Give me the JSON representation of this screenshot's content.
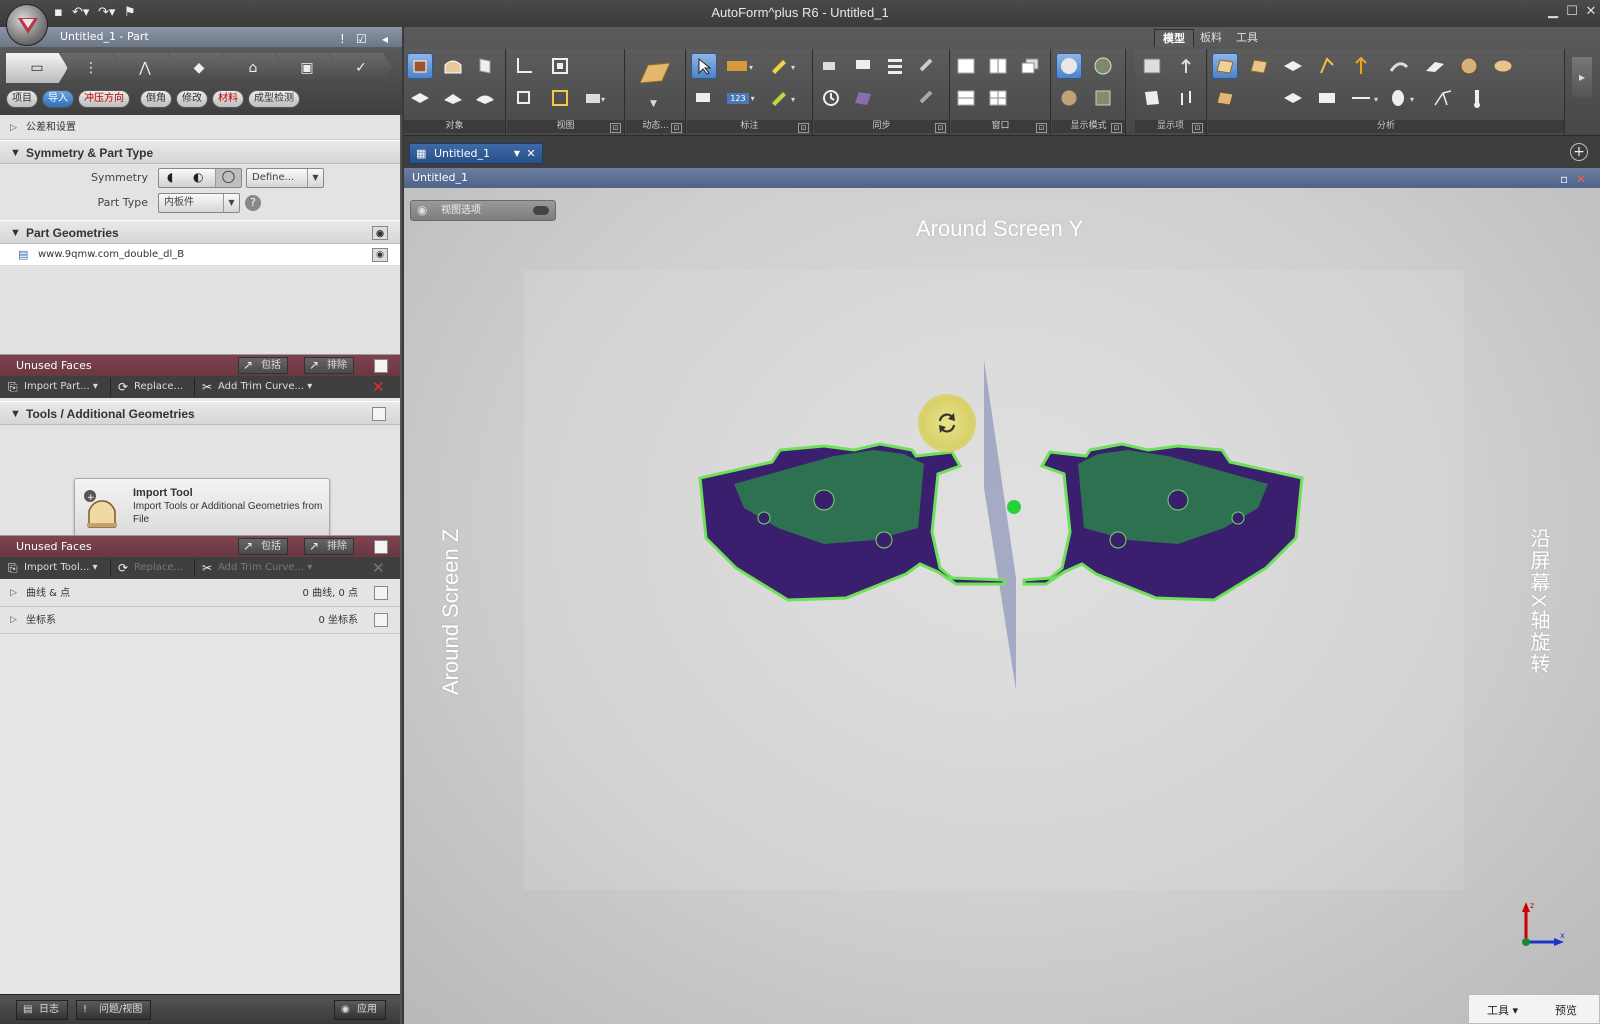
{
  "window": {
    "title": "AutoForm^plus R6 - Untitled_1"
  },
  "left_panel": {
    "doc_title": "Untitled_1 - Part",
    "process_steps": [
      "part",
      "tipping",
      "addendum",
      "binder",
      "trim",
      "simulation",
      "check"
    ],
    "sub_tabs": [
      {
        "label": "项目",
        "style": "normal"
      },
      {
        "label": "导入",
        "style": "active"
      },
      {
        "label": "冲压方向",
        "style": "red"
      },
      {
        "label": "倒角",
        "style": "normal"
      },
      {
        "label": "修改",
        "style": "normal"
      },
      {
        "label": "材料",
        "style": "red"
      },
      {
        "label": "成型检测",
        "style": "normal"
      }
    ],
    "tolerance_row": "公差和设置",
    "symmetry_section": {
      "header": "Symmetry & Part Type",
      "symmetry_label": "Symmetry",
      "define_button": "Define...",
      "part_type_label": "Part Type",
      "part_type_value": "内板件"
    },
    "part_geometries": {
      "header": "Part Geometries",
      "items": [
        "www.9qmw.com_double_dl_B"
      ]
    },
    "unused_faces_1": {
      "label": "Unused Faces",
      "include": "包括",
      "exclude": "排除"
    },
    "actions_1": {
      "import": "Import Part...",
      "replace": "Replace...",
      "add_trim": "Add Trim Curve..."
    },
    "tools_section": {
      "header": "Tools / Additional Geometries",
      "card_title": "Import Tool",
      "card_desc": "Import Tools or Additional Geometries from File"
    },
    "unused_faces_2": {
      "label": "Unused Faces",
      "include": "包括",
      "exclude": "排除"
    },
    "actions_2": {
      "import": "Import Tool...",
      "replace": "Replace...",
      "add_trim": "Add Trim Curve..."
    },
    "curves_row": {
      "label": "曲线 & 点",
      "count": "0 曲线, 0 点"
    },
    "coords_row": {
      "label": "坐标系",
      "count": "0 坐标系"
    },
    "bottom": {
      "log": "日志",
      "issues": "问题/视图",
      "apply": "应用"
    }
  },
  "ribbon": {
    "tabs": [
      {
        "label": "模型",
        "active": true
      },
      {
        "label": "板料",
        "active": false
      },
      {
        "label": "工具",
        "active": false
      }
    ],
    "groups": [
      "对象",
      "视图",
      "动态...",
      "标注",
      "同步",
      "窗口",
      "显示模式",
      "显示项",
      "分析"
    ],
    "zoom_value": "123"
  },
  "document": {
    "tab_label": "Untitled_1",
    "viewport_title": "Untitled_1",
    "view_options": "视图选项"
  },
  "viewport": {
    "label_top": "Around Screen Y",
    "label_left": "Around Screen Z",
    "label_right": "沿屏幕X轴旋转",
    "axis_x": "x",
    "axis_z": "z"
  },
  "tray": {
    "tools": "工具",
    "preview": "预览"
  },
  "colors": {
    "part_fill": "#3a1f6e",
    "part_green": "#2c7a4c",
    "part_outline": "#6fe05a",
    "rotate_handle": "#e0d979",
    "pivot": "#27d13a",
    "tab_blue": "#2f5a96"
  }
}
